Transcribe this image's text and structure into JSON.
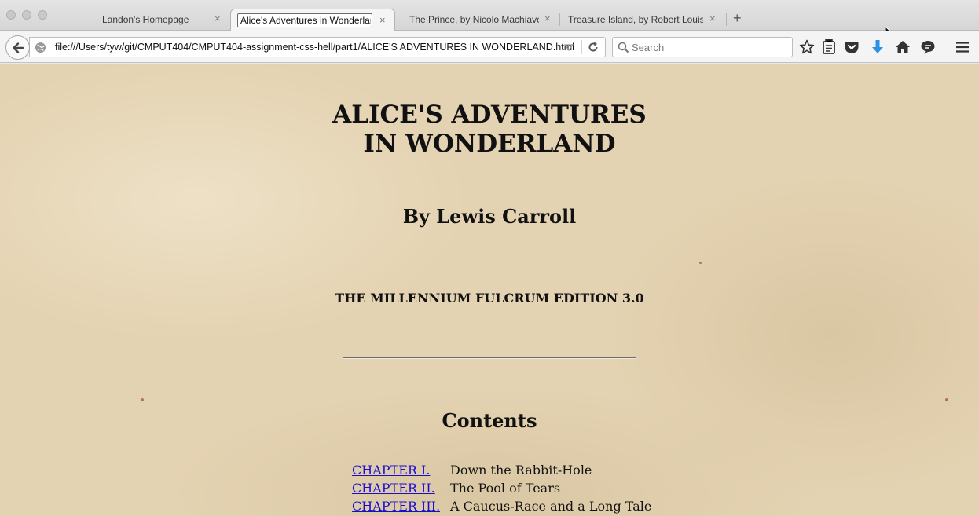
{
  "browser": {
    "tabs": [
      {
        "title": "Landon's Homepage",
        "active": false
      },
      {
        "title": "Alice's Adventures in Wonderland, ...",
        "active": true
      },
      {
        "title": "The Prince, by Nicolo Machiavelli",
        "active": false
      },
      {
        "title": "Treasure Island, by Robert Louis St...",
        "active": false
      }
    ],
    "close_glyph": "×",
    "new_tab_glyph": "+",
    "url": "file:///Users/tyw/git/CMPUT404/CMPUT404-assignment-css-hell/part1/ALICE'S ADVENTURES IN WONDERLAND.html",
    "search_placeholder": "Search",
    "icons": [
      "back-arrow-icon",
      "globe-icon",
      "dropdown-icon",
      "reload-icon",
      "search-icon",
      "star-icon",
      "reading-list-icon",
      "pocket-icon",
      "download-icon",
      "home-icon",
      "chat-icon",
      "hamburger-menu-icon"
    ],
    "download_color": "#2a90e8"
  },
  "page": {
    "title_line1": "ALICE'S ADVENTURES",
    "title_line2": "IN WONDERLAND",
    "author": "By Lewis Carroll",
    "edition": "THE MILLENNIUM FULCRUM EDITION 3.0",
    "contents_heading": "Contents",
    "link_color": "#1a0dcc",
    "toc": [
      {
        "chapter": "CHAPTER I.",
        "name": "Down the Rabbit-Hole"
      },
      {
        "chapter": "CHAPTER II.",
        "name": "The Pool of Tears"
      },
      {
        "chapter": "CHAPTER III.",
        "name": "A Caucus-Race and a Long Tale"
      }
    ]
  }
}
